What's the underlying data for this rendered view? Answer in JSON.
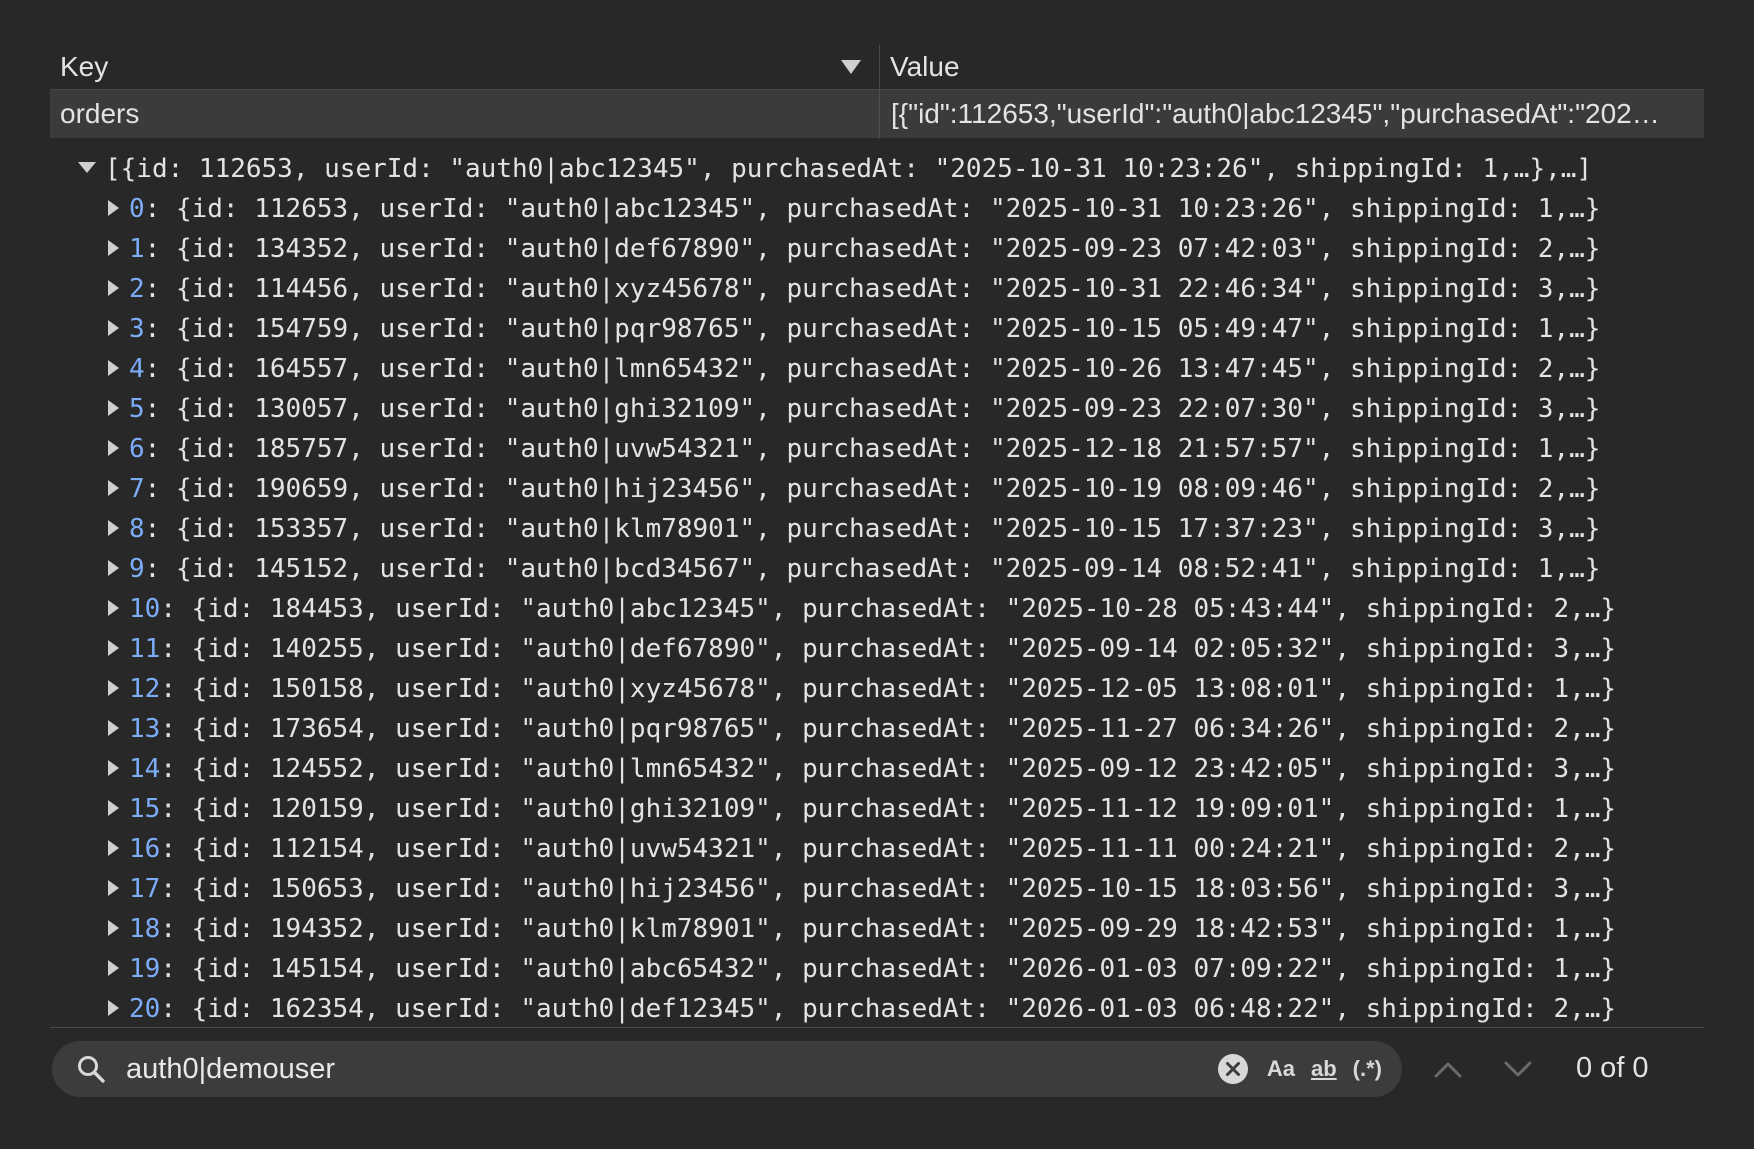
{
  "table": {
    "headers": {
      "key": "Key",
      "value": "Value"
    },
    "row": {
      "key": "orders",
      "value": "[{\"id\":112653,\"userId\":\"auth0|abc12345\",\"purchasedAt\":\"202…"
    }
  },
  "tree": {
    "root": "[{id: 112653, userId: \"auth0|abc12345\", purchasedAt: \"2025-10-31 10:23:26\", shippingId: 1,…},…]",
    "items": [
      {
        "index": "0",
        "text": "{id: 112653, userId: \"auth0|abc12345\", purchasedAt: \"2025-10-31 10:23:26\", shippingId: 1,…}"
      },
      {
        "index": "1",
        "text": "{id: 134352, userId: \"auth0|def67890\", purchasedAt: \"2025-09-23 07:42:03\", shippingId: 2,…}"
      },
      {
        "index": "2",
        "text": "{id: 114456, userId: \"auth0|xyz45678\", purchasedAt: \"2025-10-31 22:46:34\", shippingId: 3,…}"
      },
      {
        "index": "3",
        "text": "{id: 154759, userId: \"auth0|pqr98765\", purchasedAt: \"2025-10-15 05:49:47\", shippingId: 1,…}"
      },
      {
        "index": "4",
        "text": "{id: 164557, userId: \"auth0|lmn65432\", purchasedAt: \"2025-10-26 13:47:45\", shippingId: 2,…}"
      },
      {
        "index": "5",
        "text": "{id: 130057, userId: \"auth0|ghi32109\", purchasedAt: \"2025-09-23 22:07:30\", shippingId: 3,…}"
      },
      {
        "index": "6",
        "text": "{id: 185757, userId: \"auth0|uvw54321\", purchasedAt: \"2025-12-18 21:57:57\", shippingId: 1,…}"
      },
      {
        "index": "7",
        "text": "{id: 190659, userId: \"auth0|hij23456\", purchasedAt: \"2025-10-19 08:09:46\", shippingId: 2,…}"
      },
      {
        "index": "8",
        "text": "{id: 153357, userId: \"auth0|klm78901\", purchasedAt: \"2025-10-15 17:37:23\", shippingId: 3,…}"
      },
      {
        "index": "9",
        "text": "{id: 145152, userId: \"auth0|bcd34567\", purchasedAt: \"2025-09-14 08:52:41\", shippingId: 1,…}"
      },
      {
        "index": "10",
        "text": "{id: 184453, userId: \"auth0|abc12345\", purchasedAt: \"2025-10-28 05:43:44\", shippingId: 2,…}"
      },
      {
        "index": "11",
        "text": "{id: 140255, userId: \"auth0|def67890\", purchasedAt: \"2025-09-14 02:05:32\", shippingId: 3,…}"
      },
      {
        "index": "12",
        "text": "{id: 150158, userId: \"auth0|xyz45678\", purchasedAt: \"2025-12-05 13:08:01\", shippingId: 1,…}"
      },
      {
        "index": "13",
        "text": "{id: 173654, userId: \"auth0|pqr98765\", purchasedAt: \"2025-11-27 06:34:26\", shippingId: 2,…}"
      },
      {
        "index": "14",
        "text": "{id: 124552, userId: \"auth0|lmn65432\", purchasedAt: \"2025-09-12 23:42:05\", shippingId: 3,…}"
      },
      {
        "index": "15",
        "text": "{id: 120159, userId: \"auth0|ghi32109\", purchasedAt: \"2025-11-12 19:09:01\", shippingId: 1,…}"
      },
      {
        "index": "16",
        "text": "{id: 112154, userId: \"auth0|uvw54321\", purchasedAt: \"2025-11-11 00:24:21\", shippingId: 2,…}"
      },
      {
        "index": "17",
        "text": "{id: 150653, userId: \"auth0|hij23456\", purchasedAt: \"2025-10-15 18:03:56\", shippingId: 3,…}"
      },
      {
        "index": "18",
        "text": "{id: 194352, userId: \"auth0|klm78901\", purchasedAt: \"2025-09-29 18:42:53\", shippingId: 1,…}"
      },
      {
        "index": "19",
        "text": "{id: 145154, userId: \"auth0|abc65432\", purchasedAt: \"2026-01-03 07:09:22\", shippingId: 1,…}"
      },
      {
        "index": "20",
        "text": "{id: 162354, userId: \"auth0|def12345\", purchasedAt: \"2026-01-03 06:48:22\", shippingId: 2,…}"
      }
    ]
  },
  "search": {
    "value": "auth0|demouser",
    "options": {
      "match_case": "Aa",
      "whole_word": "ab",
      "regex": "(.*)"
    },
    "match_count": "0 of 0"
  },
  "icons": {
    "sort": "sort-arrow-icon",
    "search": "search-icon",
    "clear": "clear-icon",
    "prev": "chevron-up-icon",
    "next": "chevron-down-icon"
  },
  "colors": {
    "background": "#282828",
    "row_highlight": "#3b3b3b",
    "index": "#7cacf8",
    "search_bg": "#3c3c3c"
  }
}
